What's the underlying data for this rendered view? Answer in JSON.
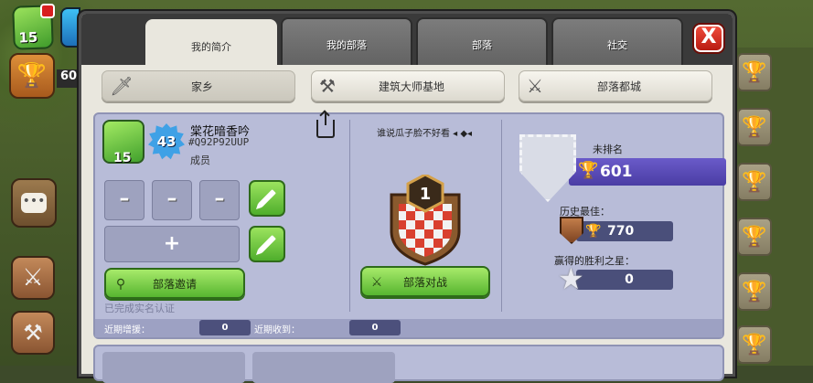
{
  "hud": {
    "town_hall_level": "15",
    "trophy_short": "60"
  },
  "tabs": [
    {
      "label": "我的简介",
      "active": true
    },
    {
      "label": "我的部落",
      "active": false
    },
    {
      "label": "部落",
      "active": false
    },
    {
      "label": "社交",
      "active": false
    }
  ],
  "close_label": "X",
  "subtabs": [
    {
      "label": "家乡",
      "icon": "sword-icon",
      "active": true
    },
    {
      "label": "建筑大师基地",
      "icon": "crossed-axes-icon",
      "active": false
    },
    {
      "label": "部落都城",
      "icon": "crossed-swords-icon",
      "active": false
    }
  ],
  "player": {
    "town_hall_level": "15",
    "exp_level": "43",
    "name": "棠花暗香吟",
    "tag": "#Q92P92UUP",
    "role": "成员"
  },
  "slots": {
    "dash1": "–",
    "dash2": "–",
    "dash3": "–",
    "plus": "+"
  },
  "buttons": {
    "clan_invite": "部落邀请",
    "clan_war": "部落对战"
  },
  "verify_text": "已完成实名认证",
  "clan": {
    "motto": "谁说瓜子脸不好看 ◂ ◆◂",
    "rank": "1"
  },
  "league": {
    "unranked_label": "未排名",
    "trophies": "601",
    "best_label": "历史最佳：",
    "best_value": "770",
    "best_emblem_num": "1",
    "stars_label": "赢得的胜利之星：",
    "stars_value": "0"
  },
  "stats": {
    "donated_label": "近期增援：",
    "donated_value": "0",
    "received_label": "近期收到：",
    "received_value": "0"
  },
  "colors": {
    "accent_green": "#57b530",
    "trophy_bar": "#4a3da4",
    "close_red": "#d0291b"
  }
}
